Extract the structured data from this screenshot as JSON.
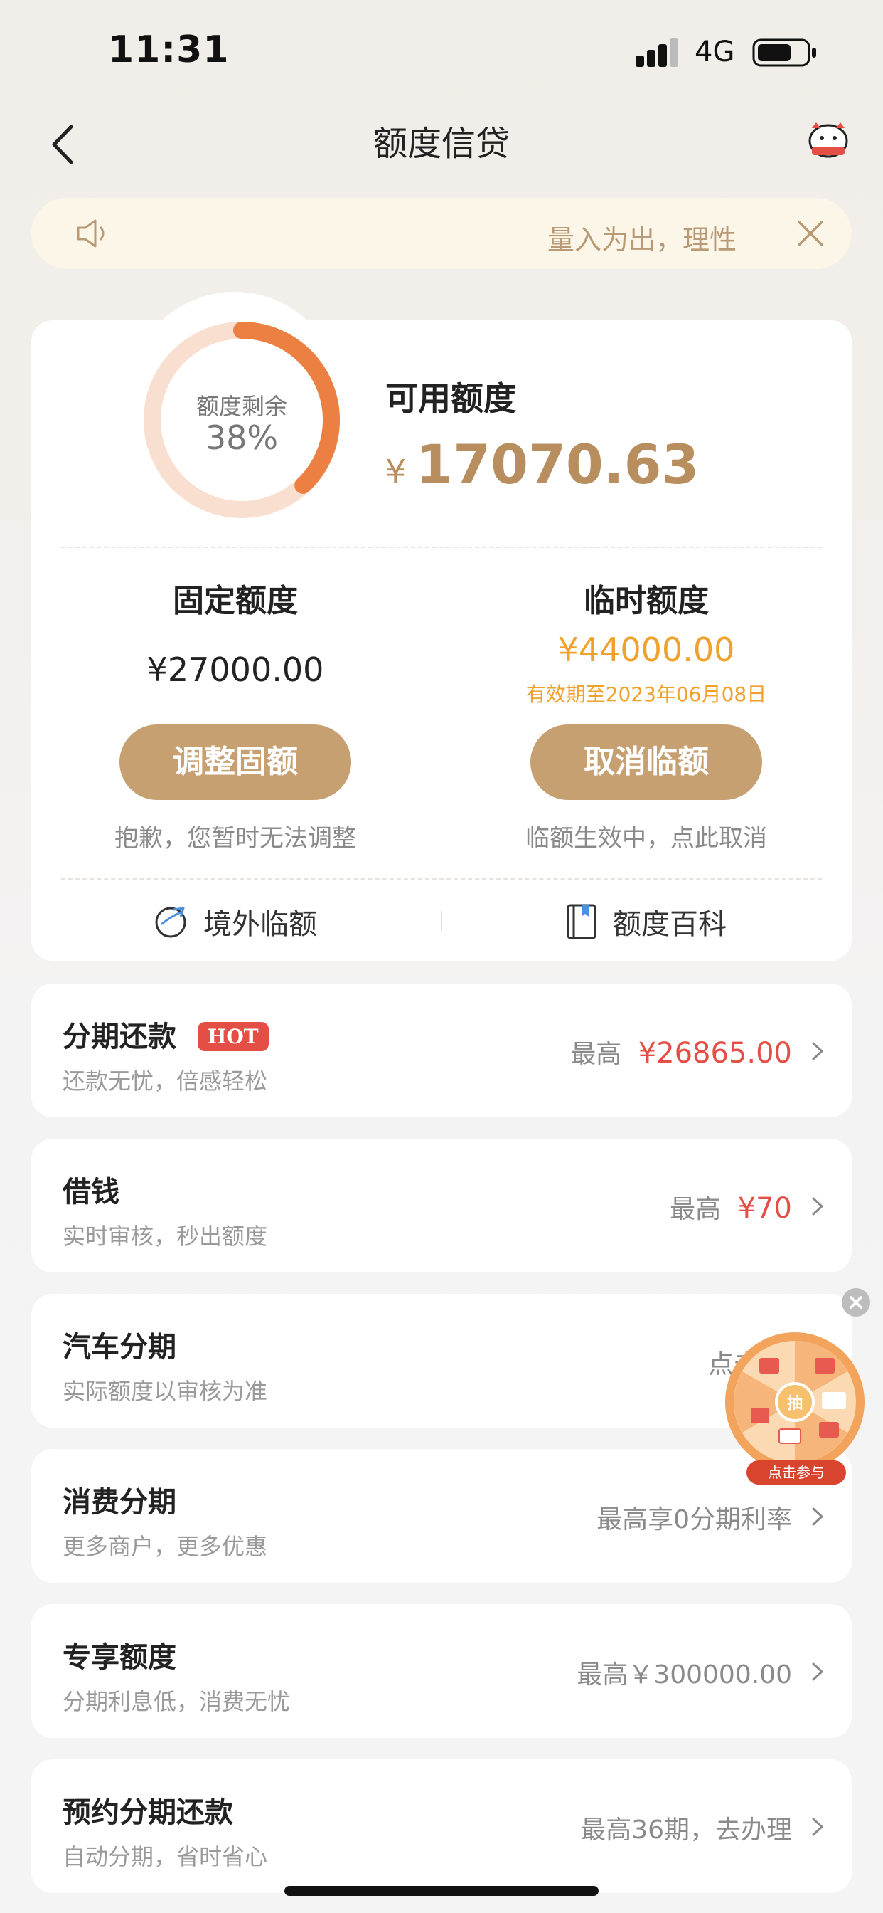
{
  "status_bar": {
    "time": "11:31",
    "network": "4G"
  },
  "nav": {
    "title": "额度信贷"
  },
  "notice": {
    "text": "量入为出，理性"
  },
  "quota": {
    "ring_label": "额度剩余",
    "ring_percent_text": "38%",
    "ring_percent": 0.38,
    "available_label": "可用额度",
    "available_currency": "¥",
    "available_amount": "17070.63",
    "fixed": {
      "title": "固定额度",
      "amount": "¥27000.00",
      "button": "调整固额",
      "note": "抱歉，您暂时无法调整"
    },
    "temp": {
      "title": "临时额度",
      "amount": "¥44000.00",
      "validity": "有效期至2023年06月08日",
      "button": "取消临额",
      "note": "临额生效中，点此取消"
    },
    "links": [
      {
        "label": "境外临额",
        "icon": "globe-plane-icon"
      },
      {
        "label": "额度百科",
        "icon": "book-icon"
      }
    ]
  },
  "rows": [
    {
      "title": "分期还款",
      "badge": "HOT",
      "subtitle": "还款无忧，倍感轻松",
      "prefix": "最高",
      "amount": "¥26865.00"
    },
    {
      "title": "借钱",
      "subtitle": "实时审核，秒出额度",
      "prefix": "最高",
      "amount": "¥70"
    },
    {
      "title": "汽车分期",
      "subtitle": "实际额度以审核为准",
      "prefix": "点击"
    },
    {
      "title": "消费分期",
      "subtitle": "更多商户，更多优惠",
      "prefix": "最高享0分期利率"
    },
    {
      "title": "专享额度",
      "subtitle": "分期利息低，消费无忧",
      "prefix": "最高￥300000.00"
    },
    {
      "title": "预约分期还款",
      "subtitle": "自动分期，省时省心",
      "prefix": "最高36期，去办理"
    }
  ],
  "wheel": {
    "center": "抽",
    "cta": "点击参与"
  },
  "colors": {
    "accent": "#c7a072",
    "ring": "#ec7f42",
    "ring_track": "#f9dfcf",
    "temp_amount": "#f0a02b",
    "red": "#e54e45"
  }
}
